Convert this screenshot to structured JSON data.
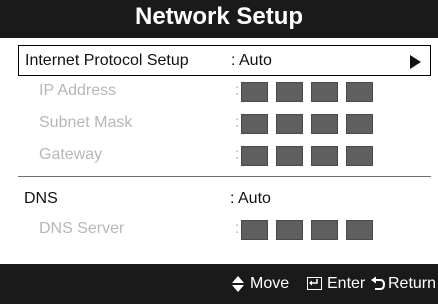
{
  "window": {
    "title": "Network Setup"
  },
  "settings": {
    "protocol": {
      "label": "Internet Protocol Setup",
      "value": ": Auto",
      "has_submenu_arrow": true
    },
    "ip_address": {
      "label": "IP Address",
      "value_prefix": ":"
    },
    "subnet_mask": {
      "label": "Subnet Mask",
      "value_prefix": ":"
    },
    "gateway": {
      "label": "Gateway",
      "value_prefix": ":"
    },
    "dns": {
      "label": "DNS",
      "value": ": Auto"
    },
    "dns_server": {
      "label": "DNS Server",
      "value_prefix": ":"
    }
  },
  "footer": {
    "move_label": "Move",
    "enter_label": "Enter",
    "return_label": "Return"
  },
  "icons": {
    "move": "up-down-arrows-icon",
    "enter": "enter-icon",
    "return": "return-icon",
    "submenu": "right-triangle-icon"
  },
  "colors": {
    "bar_bg": "#1a1a1a",
    "panel_bg": "#ffffff",
    "text": "#111111",
    "disabled_text": "#b7b7b7",
    "address_box": "#5f5f5f"
  }
}
